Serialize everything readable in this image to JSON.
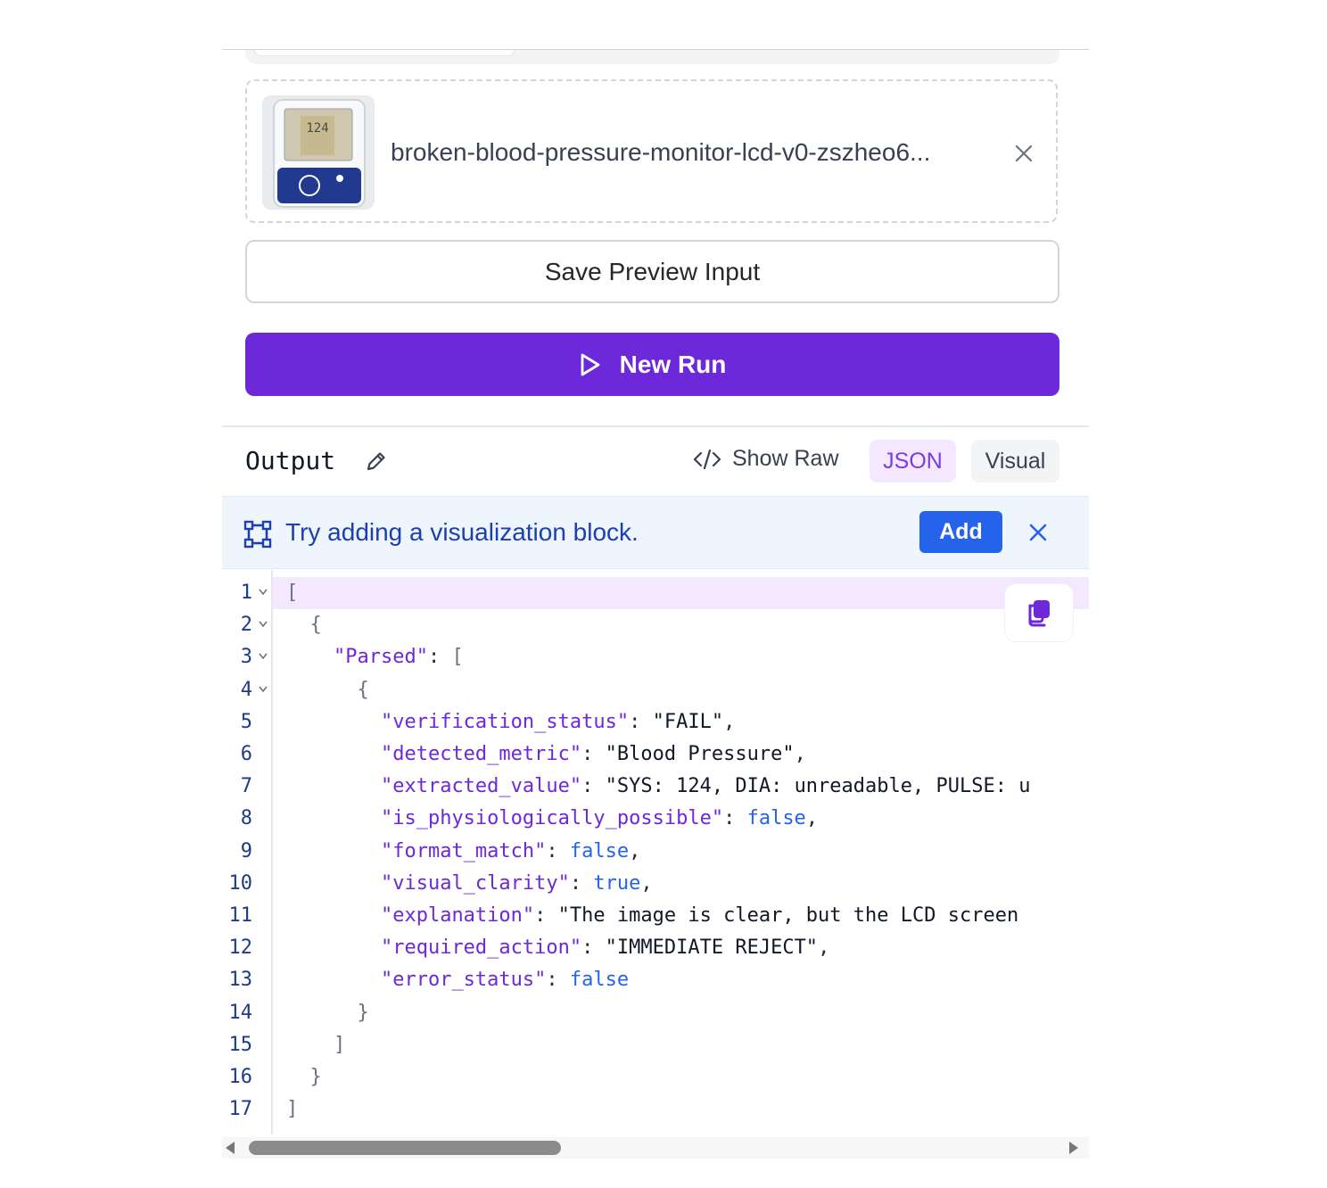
{
  "upload": {
    "file_name": "broken-blood-pressure-monitor-lcd-v0-zszheo6...",
    "thumbnail_reading": "124"
  },
  "actions": {
    "save_label": "Save Preview Input",
    "run_label": "New Run"
  },
  "output": {
    "title": "Output",
    "show_raw_label": "Show Raw",
    "tabs": [
      "JSON",
      "Visual"
    ],
    "active_tab": "JSON"
  },
  "banner": {
    "text": "Try adding a visualization block.",
    "add_label": "Add"
  },
  "code": {
    "line_numbers": [
      "1",
      "2",
      "3",
      "4",
      "5",
      "6",
      "7",
      "8",
      "9",
      "10",
      "11",
      "12",
      "13",
      "14",
      "15",
      "16",
      "17"
    ],
    "lines": [
      "[",
      "  {",
      "    \"Parsed\": [",
      "      {",
      "        \"verification_status\": \"FAIL\",",
      "        \"detected_metric\": \"Blood Pressure\",",
      "        \"extracted_value\": \"SYS: 124, DIA: unreadable, PULSE: u",
      "        \"is_physiologically_possible\": false,",
      "        \"format_match\": false,",
      "        \"visual_clarity\": true,",
      "        \"explanation\": \"The image is clear, but the LCD screen",
      "        \"required_action\": \"IMMEDIATE REJECT\",",
      "        \"error_status\": false",
      "      }",
      "    ]",
      "  }",
      "]"
    ],
    "foldable_lines": [
      1,
      2,
      3,
      4
    ],
    "highlighted_line": 1
  },
  "colors": {
    "primary": "#6d28d9",
    "banner_bg": "#eef5fd",
    "add_button": "#2563eb",
    "json_key": "#6d28d9",
    "json_boolean": "#2563eb"
  }
}
